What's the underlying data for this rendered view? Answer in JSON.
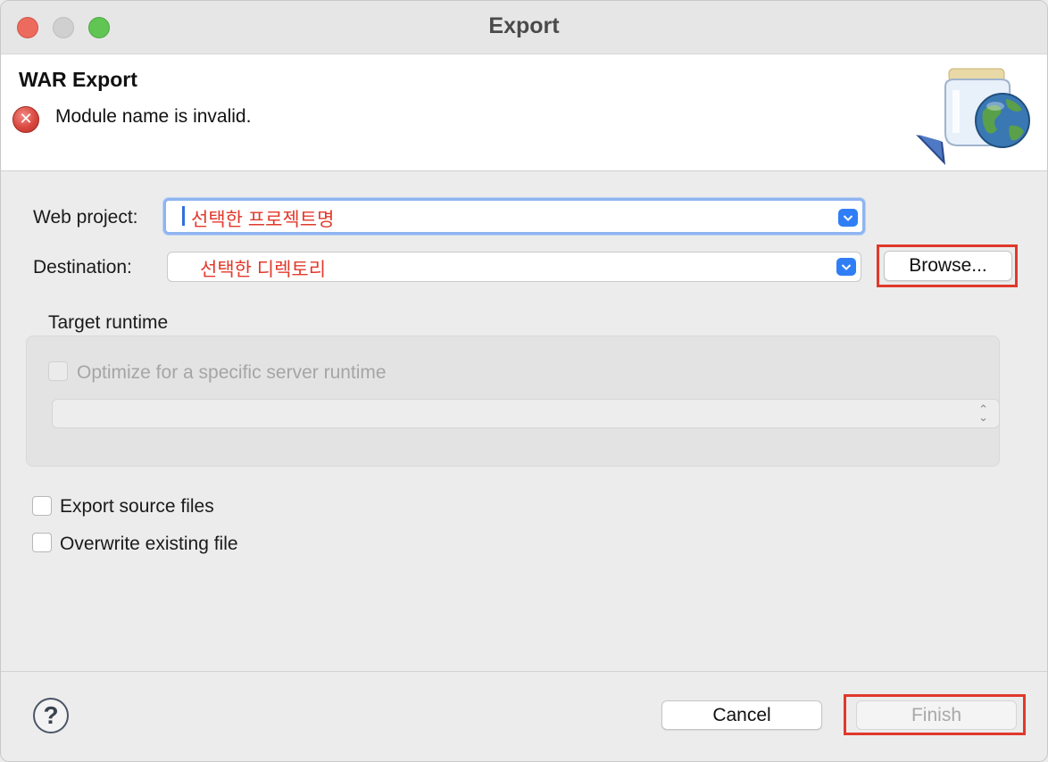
{
  "window": {
    "title": "Export"
  },
  "banner": {
    "title": "WAR Export",
    "message": "Module name is invalid.",
    "error_icon": "error-x-icon",
    "art_icon": "war-jar-globe-icon"
  },
  "form": {
    "web_project_label": "Web project:",
    "web_project_value": "선택한 프로젝트명",
    "destination_label": "Destination:",
    "destination_value": "선택한 디렉토리",
    "browse_label": "Browse..."
  },
  "target_runtime": {
    "group_label": "Target runtime",
    "optimize_label": "Optimize for a specific server runtime",
    "optimize_checked": false,
    "runtime_value": ""
  },
  "options": {
    "export_source_label": "Export source files",
    "export_source_checked": false,
    "overwrite_label": "Overwrite existing file",
    "overwrite_checked": false
  },
  "footer": {
    "help_symbol": "?",
    "cancel_label": "Cancel",
    "finish_label": "Finish"
  },
  "colors": {
    "annotation_red": "#e0392b",
    "annotation_text_red": "#e23a2c",
    "focus_blue": "#8fb4f0",
    "combo_arrow_blue": "#2f7ef6"
  }
}
